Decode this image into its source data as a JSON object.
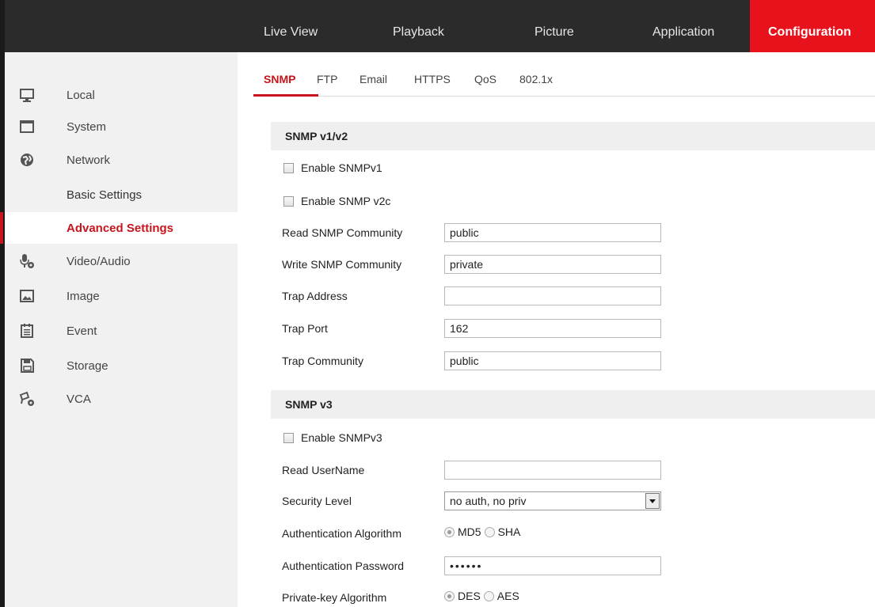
{
  "nav": {
    "items": [
      "Live View",
      "Playback",
      "Picture",
      "Application",
      "Configuration"
    ],
    "active": "Configuration",
    "accent": "#e8121c"
  },
  "sidebar": {
    "local": "Local",
    "system": "System",
    "network": "Network",
    "basic_settings": "Basic Settings",
    "advanced_settings": "Advanced Settings",
    "video_audio": "Video/Audio",
    "image": "Image",
    "event": "Event",
    "storage": "Storage",
    "vca": "VCA"
  },
  "tabs": [
    "SNMP",
    "FTP",
    "Email",
    "HTTPS",
    "QoS",
    "802.1x"
  ],
  "snmp_v1v2": {
    "title": "SNMP v1/v2",
    "enable_v1": "Enable SNMPv1",
    "enable_v2c": "Enable SNMP v2c",
    "read_community_label": "Read SNMP Community",
    "read_community_value": "public",
    "write_community_label": "Write SNMP Community",
    "write_community_value": "private",
    "trap_address_label": "Trap Address",
    "trap_address_value": "",
    "trap_port_label": "Trap Port",
    "trap_port_value": "162",
    "trap_community_label": "Trap Community",
    "trap_community_value": "public"
  },
  "snmp_v3": {
    "title": "SNMP v3",
    "enable_v3": "Enable SNMPv3",
    "read_username_label": "Read UserName",
    "read_username_value": "",
    "security_level_label": "Security Level",
    "security_level_value": "no auth, no priv",
    "auth_algo_label": "Authentication Algorithm",
    "auth_md5": "MD5",
    "auth_sha": "SHA",
    "auth_password_label": "Authentication Password",
    "auth_password_value": "••••••",
    "priv_algo_label": "Private-key Algorithm",
    "priv_des": "DES",
    "priv_aes": "AES"
  }
}
